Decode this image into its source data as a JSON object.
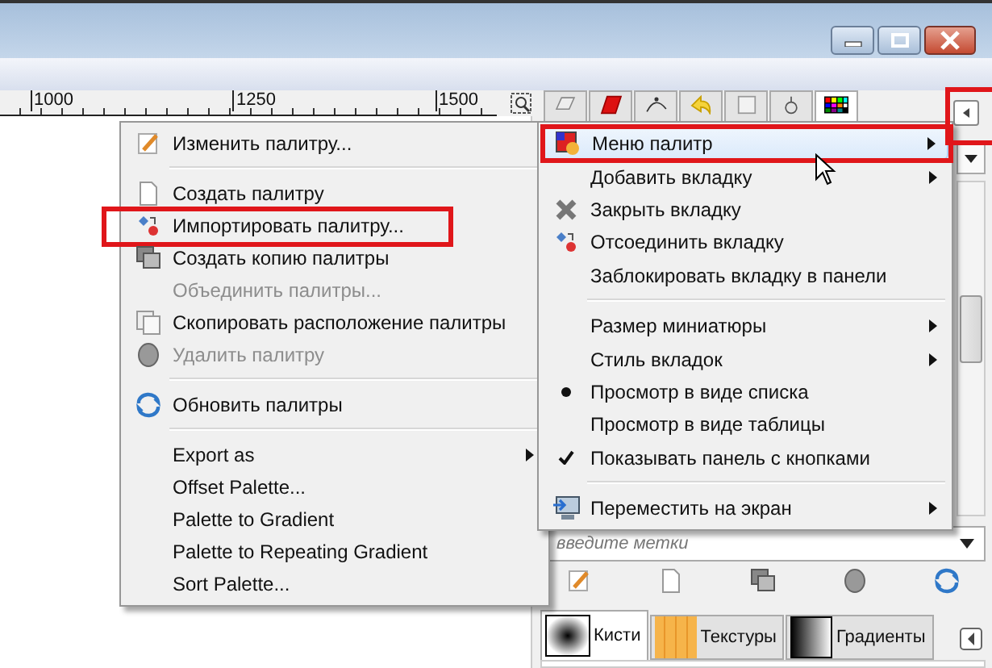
{
  "ruler": {
    "labels": [
      "1000",
      "1250",
      "1500"
    ]
  },
  "dock": {
    "tabs": [
      {
        "selected": false
      },
      {
        "selected": false
      },
      {
        "selected": false
      },
      {
        "selected": false
      },
      {
        "selected": false
      },
      {
        "selected": false
      },
      {
        "selected": true
      }
    ],
    "collapse_button": {
      "highlighted": true
    },
    "tag_field": {
      "placeholder": "введите метки"
    },
    "bottom_tabs": [
      {
        "label": "Кисти",
        "selected": true
      },
      {
        "label": "Текстуры",
        "selected": false
      },
      {
        "label": "Градиенты",
        "selected": false
      }
    ]
  },
  "palette_menu": {
    "items": [
      {
        "kind": "item",
        "label": "Изменить палитру...",
        "disabled": false,
        "submenu": false,
        "highlighted": false
      },
      {
        "kind": "separator"
      },
      {
        "kind": "item",
        "label": "Создать палитру",
        "disabled": false,
        "submenu": false,
        "highlighted": false
      },
      {
        "kind": "item",
        "label": "Импортировать палитру...",
        "disabled": false,
        "submenu": false,
        "highlighted": true
      },
      {
        "kind": "item",
        "label": "Создать копию палитры",
        "disabled": false,
        "submenu": false,
        "highlighted": false
      },
      {
        "kind": "item",
        "label": "Объединить палитры...",
        "disabled": true,
        "submenu": false,
        "highlighted": false
      },
      {
        "kind": "item",
        "label": "Скопировать расположение палитры",
        "disabled": false,
        "submenu": false,
        "highlighted": false
      },
      {
        "kind": "item",
        "label": "Удалить палитру",
        "disabled": true,
        "submenu": false,
        "highlighted": false
      },
      {
        "kind": "separator"
      },
      {
        "kind": "item",
        "label": "Обновить палитры",
        "disabled": false,
        "submenu": false,
        "highlighted": false
      },
      {
        "kind": "separator"
      },
      {
        "kind": "item",
        "label": "Export as",
        "disabled": false,
        "submenu": true,
        "highlighted": false
      },
      {
        "kind": "item",
        "label": "Offset Palette...",
        "disabled": false,
        "submenu": false,
        "highlighted": false
      },
      {
        "kind": "item",
        "label": "Palette to Gradient",
        "disabled": false,
        "submenu": false,
        "highlighted": false
      },
      {
        "kind": "item",
        "label": "Palette to Repeating Gradient",
        "disabled": false,
        "submenu": false,
        "highlighted": false
      },
      {
        "kind": "item",
        "label": "Sort Palette...",
        "disabled": false,
        "submenu": false,
        "highlighted": false
      }
    ]
  },
  "dock_menu": {
    "items": [
      {
        "kind": "item",
        "label": "Меню палитр",
        "submenu": true,
        "hovered": true,
        "highlighted": true
      },
      {
        "kind": "item",
        "label": "Добавить вкладку",
        "submenu": true,
        "hovered": false,
        "highlighted": false
      },
      {
        "kind": "item",
        "label": "Закрыть вкладку",
        "submenu": false,
        "hovered": false,
        "highlighted": false
      },
      {
        "kind": "item",
        "label": "Отсоединить вкладку",
        "submenu": false,
        "hovered": false,
        "highlighted": false
      },
      {
        "kind": "item",
        "label": "Заблокировать вкладку в панели",
        "submenu": false,
        "hovered": false,
        "highlighted": false
      },
      {
        "kind": "separator"
      },
      {
        "kind": "item",
        "label": "Размер миниатюры",
        "submenu": true,
        "hovered": false,
        "highlighted": false
      },
      {
        "kind": "item",
        "label": "Стиль вкладок",
        "submenu": true,
        "hovered": false,
        "highlighted": false
      },
      {
        "kind": "radio",
        "label": "Просмотр в виде списка",
        "selected": true
      },
      {
        "kind": "radio",
        "label": "Просмотр в виде таблицы",
        "selected": false
      },
      {
        "kind": "check",
        "label": "Показывать панель с кнопками",
        "checked": true
      },
      {
        "kind": "separator"
      },
      {
        "kind": "item",
        "label": "Переместить на экран",
        "submenu": true,
        "hovered": false,
        "highlighted": false
      }
    ]
  }
}
